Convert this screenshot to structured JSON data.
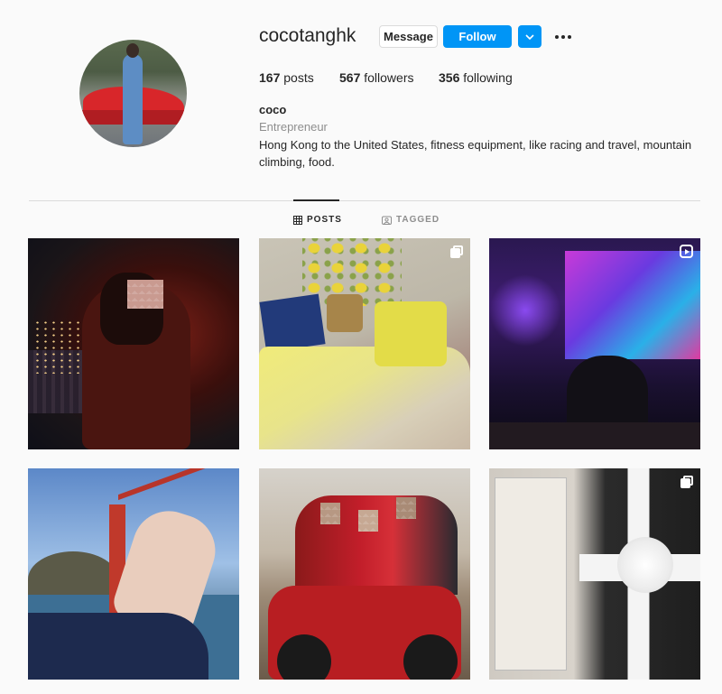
{
  "profile": {
    "username": "cocotanghk",
    "message_label": "Message",
    "follow_label": "Follow",
    "dropdown_glyph": "⌄",
    "stats": {
      "posts_count": "167",
      "posts_label": " posts",
      "followers_count": "567",
      "followers_label": " followers",
      "following_count": "356",
      "following_label": " following"
    },
    "full_name": "coco",
    "category": "Entrepreneur",
    "bio": "Hong Kong to the United States, fitness equipment, like racing and travel, mountain climbing, food."
  },
  "tabs": [
    {
      "label": "POSTS",
      "icon": "grid-icon",
      "active": true
    },
    {
      "label": "TAGGED",
      "icon": "tag-icon",
      "active": false
    }
  ],
  "posts": [
    {
      "id": 1,
      "badge": "none"
    },
    {
      "id": 2,
      "badge": "carousel-icon"
    },
    {
      "id": 3,
      "badge": "reel-icon"
    },
    {
      "id": 4,
      "badge": "none"
    },
    {
      "id": 5,
      "badge": "none"
    },
    {
      "id": 6,
      "badge": "carousel-icon"
    }
  ],
  "colors": {
    "accent": "#0095f6",
    "text": "#262626",
    "muted": "#8e8e8e",
    "border": "#dbdbdb",
    "background": "#fafafa"
  }
}
